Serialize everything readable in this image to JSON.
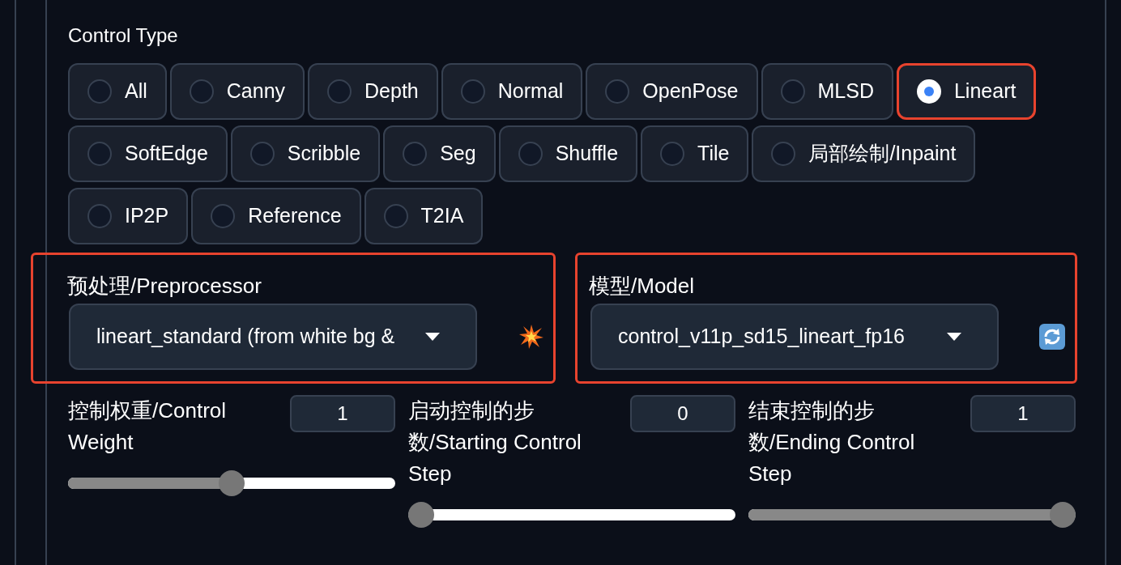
{
  "control_type": {
    "label": "Control Type",
    "rows": [
      [
        {
          "label": "All",
          "selected": false,
          "highlighted": false
        },
        {
          "label": "Canny",
          "selected": false,
          "highlighted": false
        },
        {
          "label": "Depth",
          "selected": false,
          "highlighted": false
        },
        {
          "label": "Normal",
          "selected": false,
          "highlighted": false
        },
        {
          "label": "OpenPose",
          "selected": false,
          "highlighted": false
        },
        {
          "label": "MLSD",
          "selected": false,
          "highlighted": false
        },
        {
          "label": "Lineart",
          "selected": true,
          "highlighted": true
        }
      ],
      [
        {
          "label": "SoftEdge",
          "selected": false,
          "highlighted": false
        },
        {
          "label": "Scribble",
          "selected": false,
          "highlighted": false
        },
        {
          "label": "Seg",
          "selected": false,
          "highlighted": false
        },
        {
          "label": "Shuffle",
          "selected": false,
          "highlighted": false
        },
        {
          "label": "Tile",
          "selected": false,
          "highlighted": false
        },
        {
          "label": "局部绘制/Inpaint",
          "selected": false,
          "highlighted": false
        }
      ],
      [
        {
          "label": "IP2P",
          "selected": false,
          "highlighted": false
        },
        {
          "label": "Reference",
          "selected": false,
          "highlighted": false
        },
        {
          "label": "T2IA",
          "selected": false,
          "highlighted": false
        }
      ]
    ]
  },
  "selects": [
    {
      "label": "预处理/Preprocessor",
      "value": "lineart_standard (from white bg &",
      "highlighted": true,
      "kind": "run"
    },
    {
      "label": "模型/Model",
      "value": "control_v11p_sd15_lineart_fp16",
      "highlighted": true,
      "kind": "refresh"
    }
  ],
  "sliders": [
    {
      "label": "控制权重/Control Weight",
      "value": "1",
      "level": 0.5
    },
    {
      "label": "启动控制的步数/Starting Control Step",
      "value": "0",
      "level": 0
    },
    {
      "label": "结束控制的步数/Ending Control Step",
      "value": "1",
      "level": 1
    }
  ]
}
